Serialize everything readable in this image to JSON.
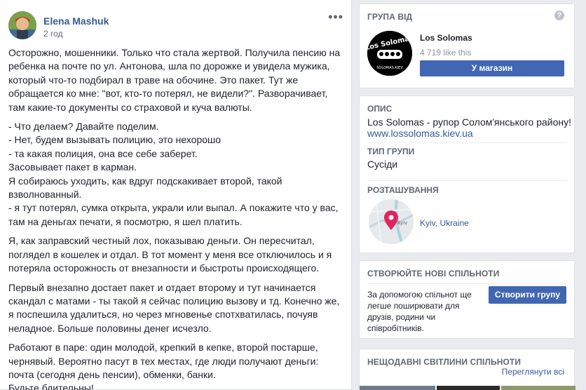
{
  "post": {
    "author": "Elena Mashuk",
    "time": "2 год",
    "more_icon": "ellipsis-icon",
    "paragraphs": [
      "Осторожно, мошенники. Только что стала жертвой. Получила пенсию на ребенка на почте по ул. Антонова, шла по дорожке и увидела мужика, который что-то подбирал в траве на обочине. Это пакет. Тут же обращается ко мне: \"вот, кто-то потерял, не видели?\". Разворачивает, там какие-то документы со страховой и куча валюты.",
      "- Что делаем? Давайте поделим.\n- Нет, будем вызывать полицию, это нехорошо\n- та какая полиция, она все себе заберет.\nЗасовывает пакет в карман.\nЯ собираюсь уходить, как вдруг подскакивает второй, такой взволнованный.\n- я тут потерял, сумка открыта, украли или выпал. А покажите что у вас, там на деньгах печати, я посмотрю, я шел платить.",
      "Я, как заправский честный лох, показываю деньги. Он пересчитал, поглядел в кошелек и отдал. В тот момент у меня все отключилось и я потеряла осторожность от внезапности и быстроты происходящего.",
      "Первый внезапно достает пакет и отдает второму и тут начинается скандал с матами - ты такой я сейчас полицию вызову и тд. Конечно же, я поспешила удалиться, но через мгновенье спотхватилась, почуяв неладное. Больше половины денег исчезло.",
      "Работают в паре: один молодой, крепкий в кепке, второй постарше, чернявый. Вероятно пасут в тех местах, где люди получают деньги: почта (сегодня день пенсии), обменки, банки.\nБудьте бдительны!"
    ]
  },
  "group_card": {
    "heading": "Група від",
    "help_icon": "?",
    "name": "Los Solomas",
    "likes": "4 719 like this",
    "shop_button": "У магазин",
    "logo_top_text": "Los Solomas",
    "logo_bottom_text": "SOLOMAS.KIEV"
  },
  "about_card": {
    "description_label": "Опис",
    "description": "Los Solomas - рупор Солом'янського району!",
    "website": "www.lossolomas.kiev.ua",
    "type_label": "Тип групи",
    "type_value": "Сусіди",
    "location_label": "Розташування",
    "location_value": "Kyiv, Ukraine",
    "map_label": "Kyiv"
  },
  "create_card": {
    "heading": "Створюйте нові спільноти",
    "description": "За допомогою спільнот ще легше поширювати для друзів, родини чи співробітників.",
    "button": "Створити групу"
  },
  "recent_card": {
    "heading": "Нещодавні світлини спільноти",
    "see_all": "Переглянути всі"
  },
  "colors": {
    "brand_blue": "#4267b2",
    "link_blue": "#365899",
    "background": "#e9ebee"
  }
}
